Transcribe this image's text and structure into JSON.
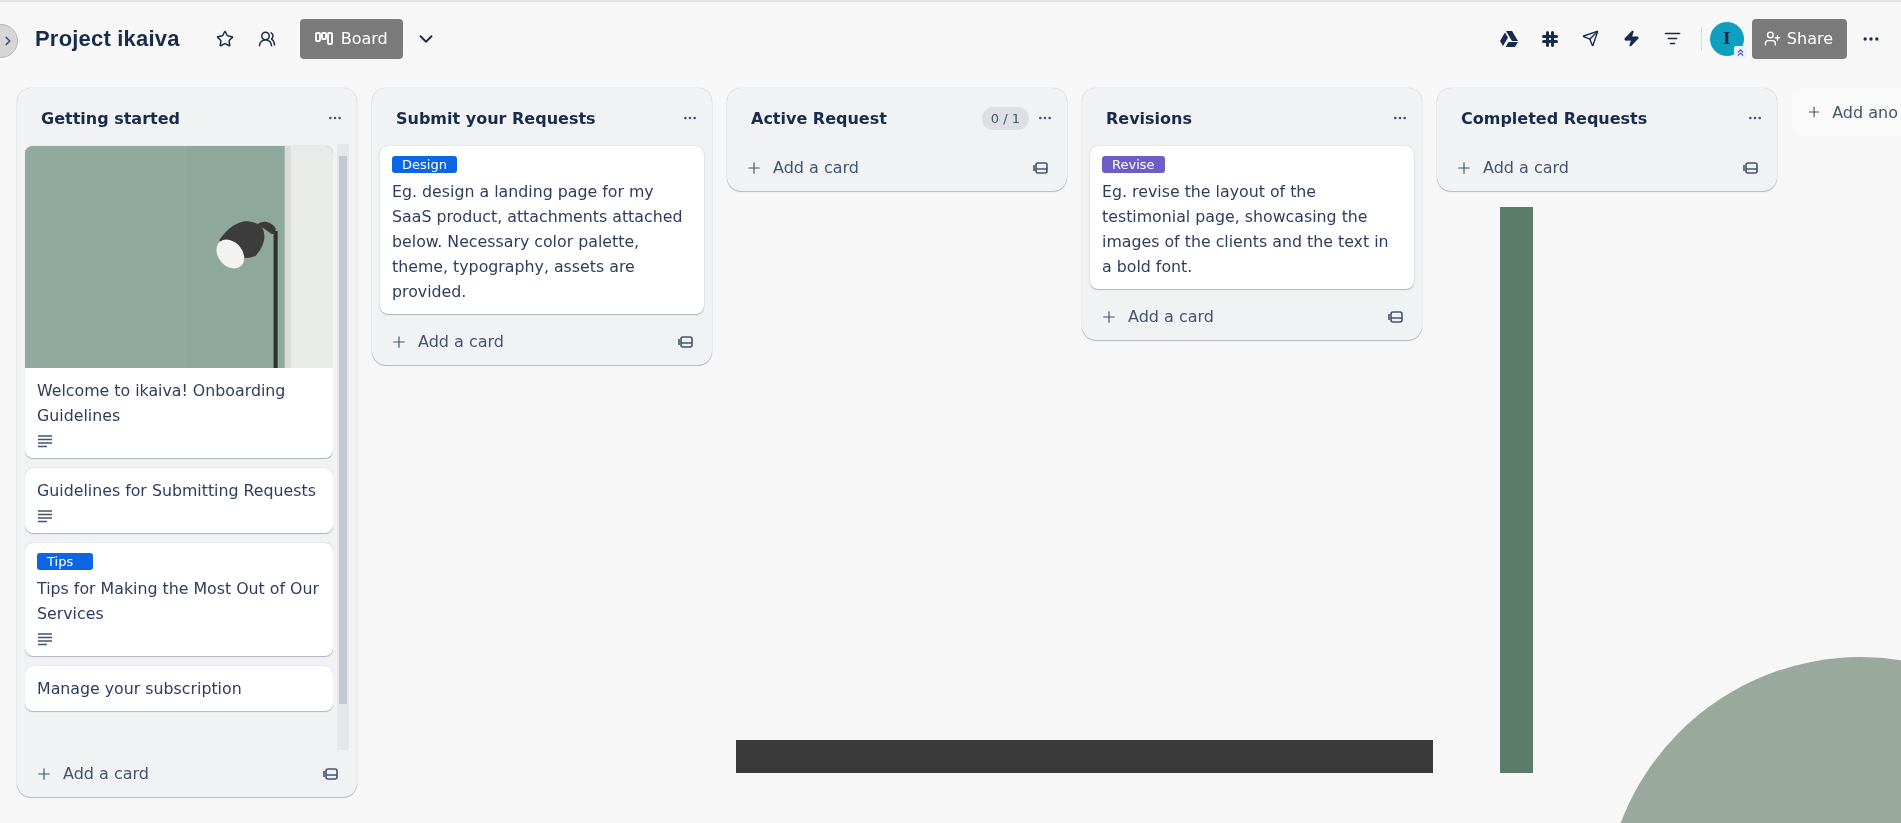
{
  "board": {
    "title": "Project ikaiva",
    "view_button": "Board"
  },
  "header": {
    "avatar_initial": "I",
    "share_button": "Share"
  },
  "lists": [
    {
      "title": "Getting started",
      "scrollable": true,
      "add_card": "Add a card",
      "cards": [
        {
          "kind": "cover",
          "text": "Welcome to ikaiva! Onboarding Guidelines",
          "description": true
        },
        {
          "kind": "text",
          "text": "Guidelines for Submitting Requests",
          "description": true
        },
        {
          "kind": "text",
          "label": {
            "text": "Tips",
            "color": "#0c66e4"
          },
          "text": "Tips for Making the Most Out of Our Services",
          "description": true
        },
        {
          "kind": "text",
          "text": "Manage your subscription",
          "description": false
        }
      ]
    },
    {
      "title": "Submit your Requests",
      "scrollable": false,
      "add_card": "Add a card",
      "cards": [
        {
          "kind": "text",
          "label": {
            "text": "Design",
            "color": "#0c66e4"
          },
          "text": "Eg. design a landing page for my SaaS product, attachments attached below. Necessary color palette, theme, typography, assets are provided.",
          "description": false
        }
      ]
    },
    {
      "title": "Active Request",
      "count": "0 / 1",
      "add_card": "Add a card"
    },
    {
      "title": "Revisions",
      "scrollable": false,
      "add_card": "Add a card",
      "cards": [
        {
          "kind": "text",
          "label": {
            "text": "Revise",
            "color": "#6e5dc6"
          },
          "text": "Eg. revise the layout of the testimonial page, showcasing the images of the clients and the text in a bold font.",
          "description": false
        }
      ]
    },
    {
      "title": "Completed Requests",
      "add_card": "Add a card"
    }
  ],
  "add_list": "Add ano"
}
